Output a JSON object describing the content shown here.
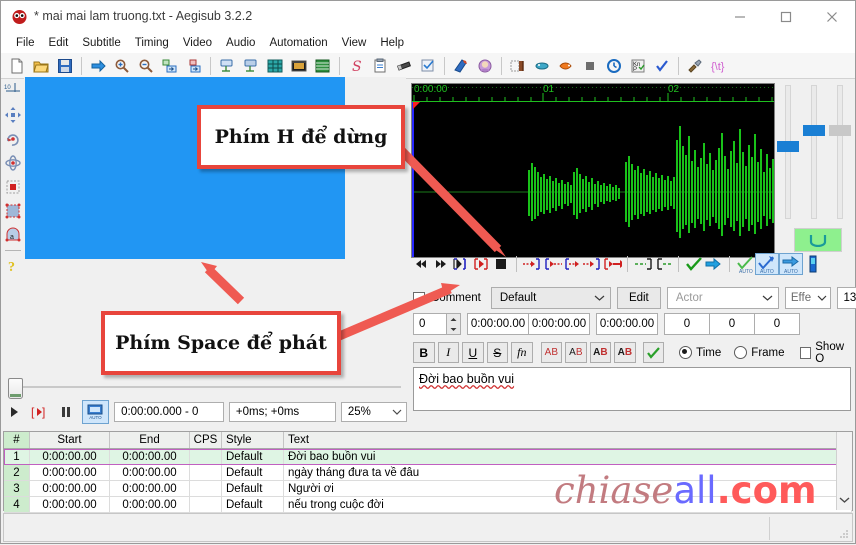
{
  "window": {
    "title": "* mai mai lam truong.txt - Aegisub 3.2.2",
    "app_icon": "aegisub-icon",
    "minimize": "minimize-icon",
    "maximize": "maximize-icon",
    "close": "close-icon"
  },
  "menubar": {
    "items": [
      "File",
      "Edit",
      "Subtitle",
      "Timing",
      "Video",
      "Audio",
      "Automation",
      "View",
      "Help"
    ]
  },
  "toolbar": {
    "groups": [
      [
        "new-subtitles-icon",
        "open-subtitles-icon",
        "save-subtitles-icon"
      ],
      [
        "jump-to-icon",
        "zoom-in-icon",
        "zoom-out-icon",
        "snap-start-to-video-icon",
        "snap-end-to-video-icon"
      ],
      [
        "shift-times-icon",
        "shift-times-back-icon",
        "styles-manager-icon",
        "attachments-icon",
        "properties-icon"
      ],
      [
        "styling-assistant-icon",
        "translation-assistant-icon",
        "resample-icon",
        "spellchecker-icon"
      ],
      [
        "open-video-icon",
        "open-audio-icon"
      ],
      [
        "close-video-icon",
        "open-keyframes-icon",
        "open-timecodes-icon",
        "stop-icon",
        "timing-postprocessor-icon",
        "kanji-timer-icon",
        "select-lines-icon"
      ],
      [
        "options-icon",
        "tags-icon"
      ]
    ]
  },
  "visual_tools": {
    "items": [
      "standard-cursor-icon",
      "drag-subtitles-icon",
      "rotate-z-icon",
      "rotate-xy-icon",
      "scale-icon",
      "rectangular-clip-icon",
      "vector-clip-icon",
      "help-icon"
    ]
  },
  "video": {
    "panel_color": "#2196f3",
    "seek_position": "0",
    "controls": {
      "play_icon": "play-icon",
      "play_line_icon": "play-line-icon",
      "pause_icon": "pause-icon",
      "auto_icon": "auto-commit-icon",
      "auto_label": "AUTO"
    },
    "position_field": "0:00:00.000 - 0",
    "offset_field": "+0ms; +0ms",
    "zoom_value": "25%"
  },
  "audio": {
    "ruler_labels": [
      "0:00:00",
      "01",
      "02"
    ],
    "waveform_color": "#19c219",
    "background_color": "#000000",
    "buttons": [
      "play-previous-line-icon",
      "play-next-line-icon",
      "play-current-line-icon",
      "play-selection-icon",
      "stop-playback-icon",
      "play-500ms-before-start-icon",
      "play-500ms-after-start-icon",
      "play-500ms-before-end-icon",
      "play-500ms-after-end-icon",
      "play-first-500ms-icon",
      "play-to-end-of-file-icon",
      "lead-in-icon",
      "lead-out-icon",
      "commit-icon",
      "go-to-next-line-icon",
      "auto-commit-icon",
      "auto-next-icon",
      "auto-scroll-icon",
      "vertical-zoom-icon"
    ],
    "slider_count": 3,
    "karaoke_button": "karaoke-mode-icon"
  },
  "edit": {
    "comment_label": "Comment",
    "comment_checked": false,
    "style_value": "Default",
    "edit_button": "Edit",
    "actor_placeholder": "Actor",
    "effect_value": "Effe",
    "layer_right_value": "13",
    "layer_value": "0",
    "start_time": "0:00:00.00",
    "end_time": "0:00:00.00",
    "duration": "0:00:00.00",
    "margin_l": "0",
    "margin_r": "0",
    "margin_v": "0",
    "format_buttons": [
      "B",
      "I",
      "U",
      "S",
      "fn"
    ],
    "color_buttons": [
      "AB",
      "AB",
      "AB",
      "AB"
    ],
    "commit_icon": "commit-check-icon",
    "time_label": "Time",
    "frame_label": "Frame",
    "time_selected": true,
    "show_original_label": "Show O",
    "show_original_checked": false,
    "text_value": "Đời bao buồn vui"
  },
  "grid": {
    "columns": [
      "#",
      "Start",
      "End",
      "CPS",
      "Style",
      "Text"
    ],
    "rows": [
      {
        "num": "1",
        "start": "0:00:00.00",
        "end": "0:00:00.00",
        "cps": "",
        "style": "Default",
        "text": "Đời bao buồn vui",
        "selected": true
      },
      {
        "num": "2",
        "start": "0:00:00.00",
        "end": "0:00:00.00",
        "cps": "",
        "style": "Default",
        "text": "ngày tháng đưa ta về đâu",
        "selected": false
      },
      {
        "num": "3",
        "start": "0:00:00.00",
        "end": "0:00:00.00",
        "cps": "",
        "style": "Default",
        "text": "Người ơi",
        "selected": false
      },
      {
        "num": "4",
        "start": "0:00:00.00",
        "end": "0:00:00.00",
        "cps": "",
        "style": "Default",
        "text": "nếu trong cuộc đời",
        "selected": false
      }
    ],
    "scroll_down_icon": "chevron-down-icon"
  },
  "annotations": {
    "callout_1": "Phím H để dừng",
    "callout_2": "Phím Space để phát",
    "border_color": "#e8453c",
    "arrow_color": "#ef5a52"
  },
  "watermark": {
    "part1": "chiase",
    "part2": "all",
    "part3": ".com",
    "color1": "#c27b80",
    "color2": "#6a6aff",
    "color3": "#ff5a5a"
  }
}
